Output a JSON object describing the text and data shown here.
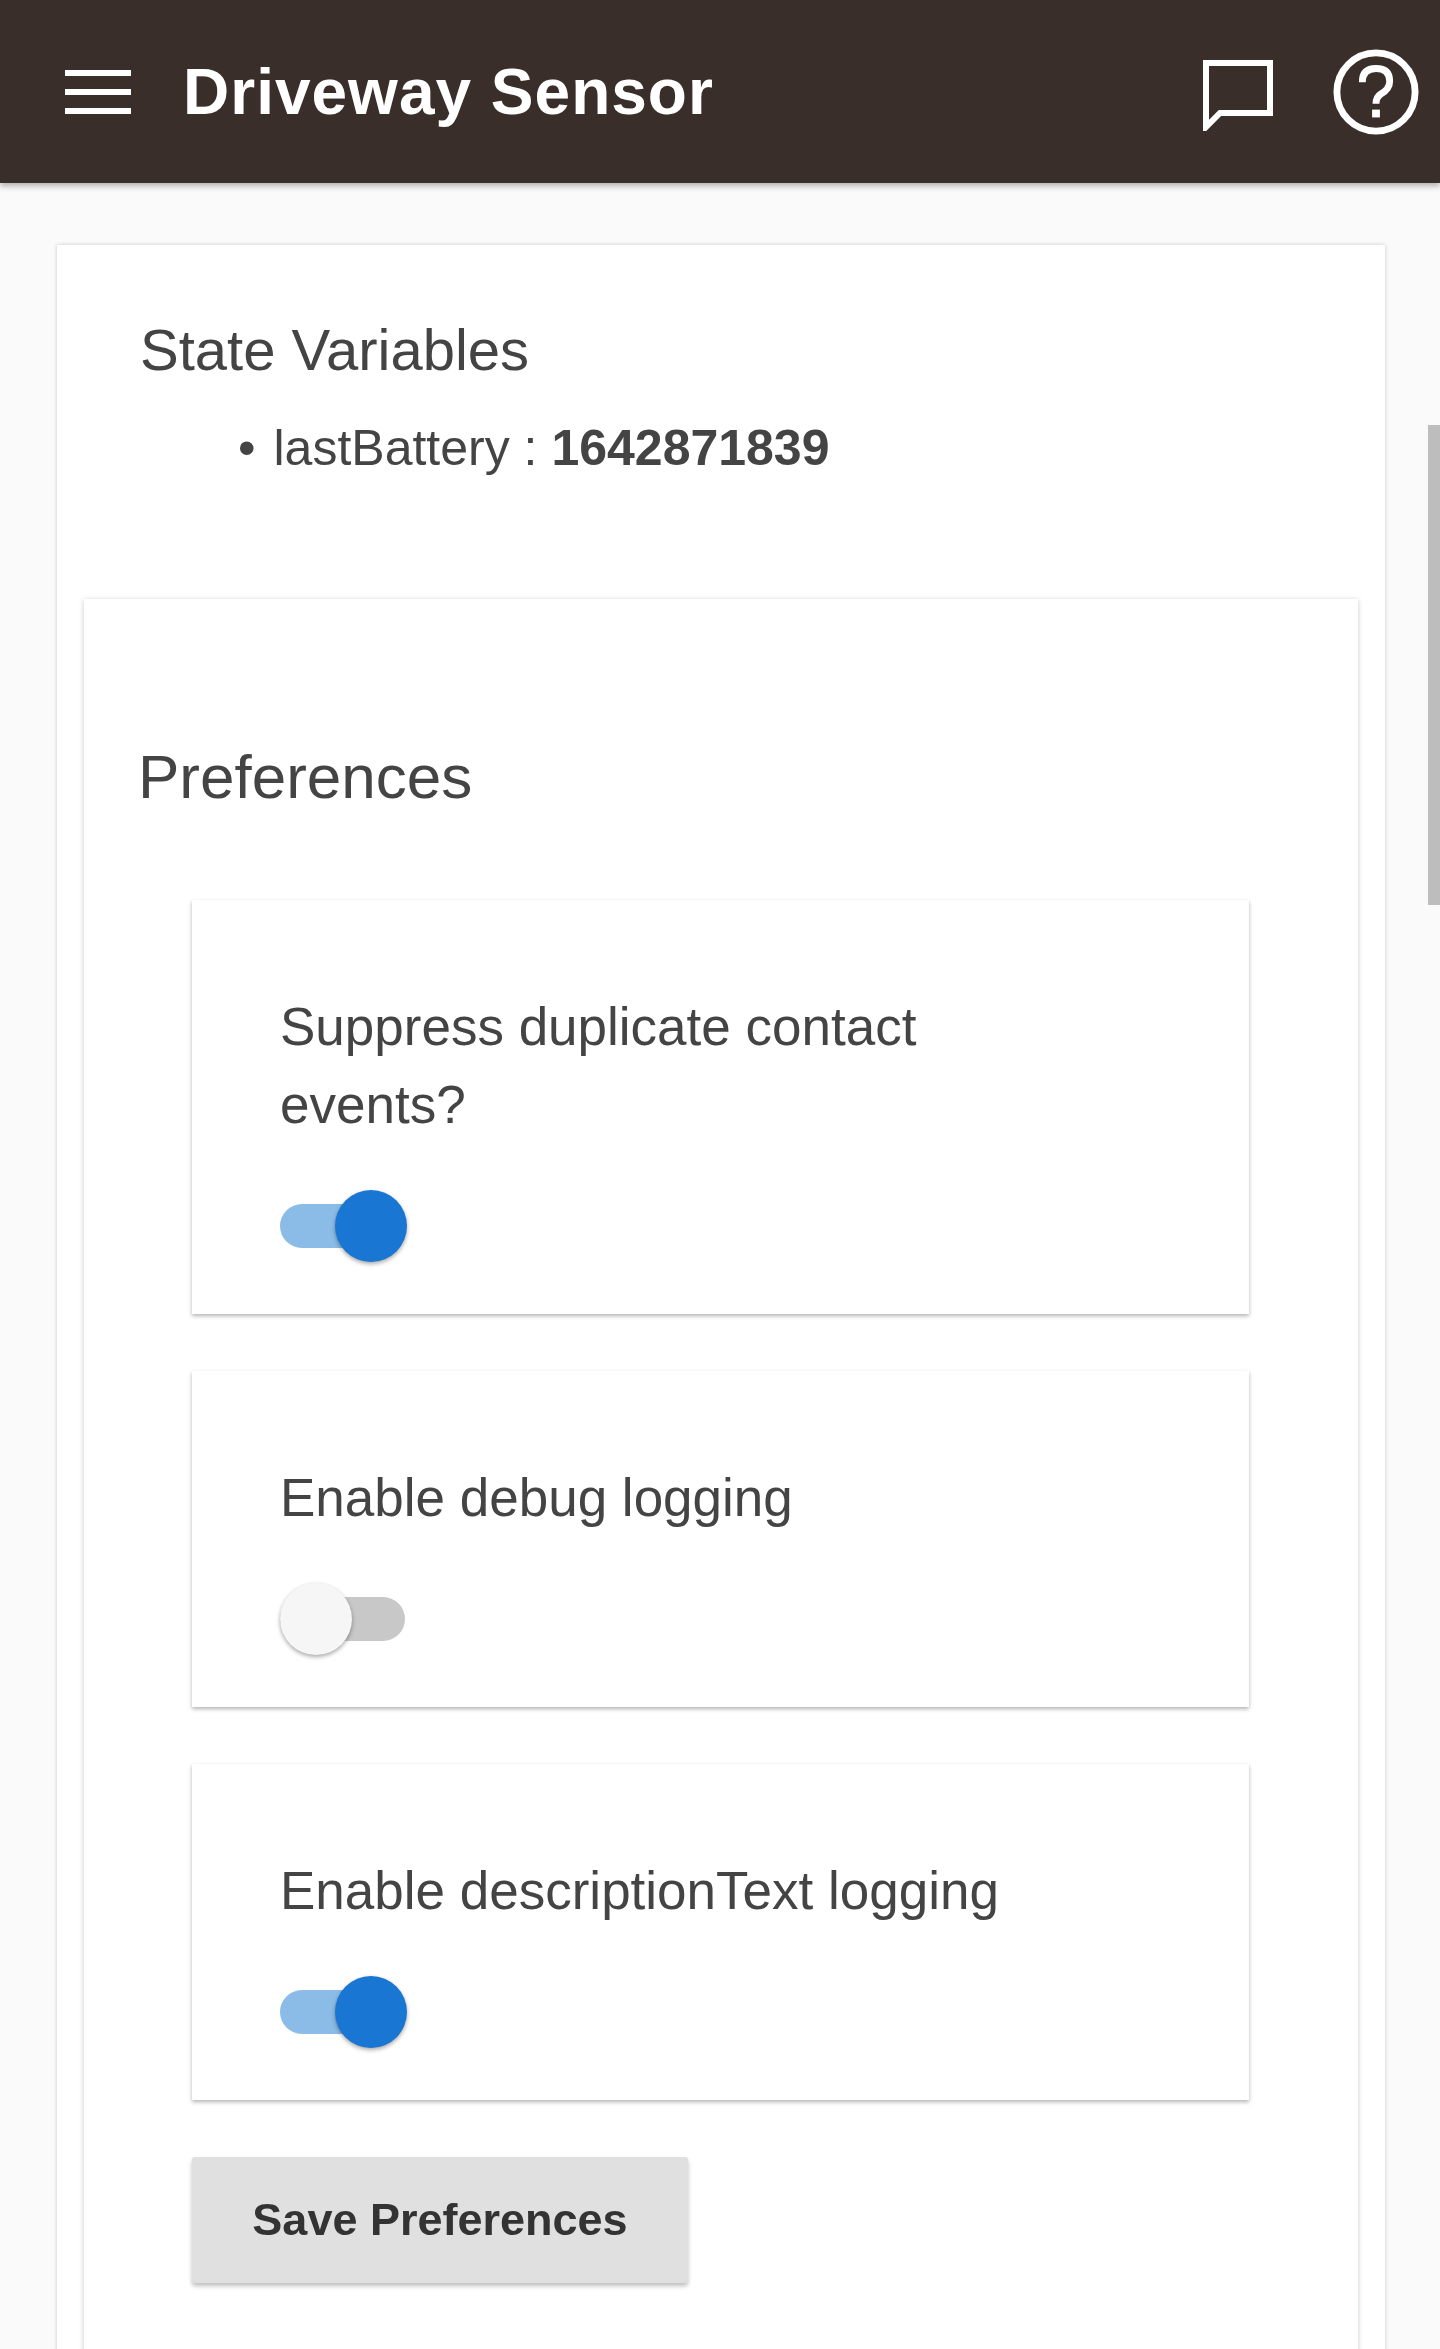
{
  "app_bar": {
    "title": "Driveway Sensor"
  },
  "state_variables": {
    "title": "State Variables",
    "items": [
      {
        "bullet": "•",
        "text": "lastBattery : **1642871839**"
      }
    ]
  },
  "preferences": {
    "title": "Preferences",
    "items": [
      {
        "label": "Suppress duplicate contact events?",
        "on": true
      },
      {
        "label": "Enable debug logging",
        "on": false
      },
      {
        "label": "Enable descriptionText logging",
        "on": true
      }
    ],
    "save_button": "Save Preferences"
  }
}
